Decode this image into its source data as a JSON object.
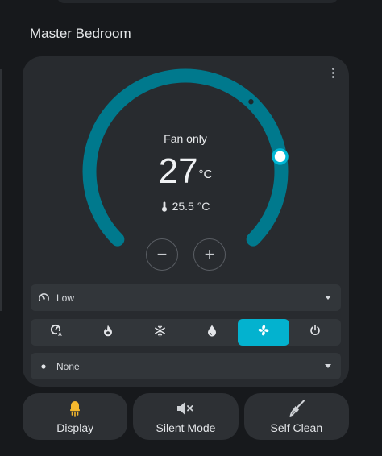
{
  "room": {
    "title": "Master Bedroom"
  },
  "thermostat": {
    "mode_label": "Fan only",
    "target_temperature": "27",
    "target_unit": "°C",
    "current_temperature": "25.5 °C",
    "decrease_symbol": "−",
    "increase_symbol": "+",
    "dial_fraction": 0.8,
    "current_fraction": 0.66,
    "colors": {
      "arc": "#00798d",
      "handle": "#00b6d4",
      "marker": "#1b2a2e"
    }
  },
  "fan_select": {
    "value": "Low",
    "icon": "fan-speed-icon"
  },
  "hvac_modes": [
    {
      "name": "auto",
      "icon": "auto-mode-icon",
      "active": false
    },
    {
      "name": "heat",
      "icon": "flame-icon",
      "active": false
    },
    {
      "name": "cool",
      "icon": "snowflake-icon",
      "active": false
    },
    {
      "name": "dry",
      "icon": "water-drop-icon",
      "active": false
    },
    {
      "name": "fan_only",
      "icon": "fan-icon",
      "active": true
    },
    {
      "name": "off",
      "icon": "power-icon",
      "active": false
    }
  ],
  "preset_select": {
    "value": "None",
    "icon": "dot-icon"
  },
  "tiles": [
    {
      "label": "Display",
      "icon": "lightbulb-icon",
      "icon_color": "#f5b82e"
    },
    {
      "label": "Silent Mode",
      "icon": "speaker-mute-icon",
      "icon_color": "#cfd2d6"
    },
    {
      "label": "Self Clean",
      "icon": "broom-icon",
      "icon_color": "#cfd2d6"
    }
  ],
  "colors": {
    "accent": "#03b2cf",
    "card": "#282b2f",
    "background": "#17191c"
  }
}
